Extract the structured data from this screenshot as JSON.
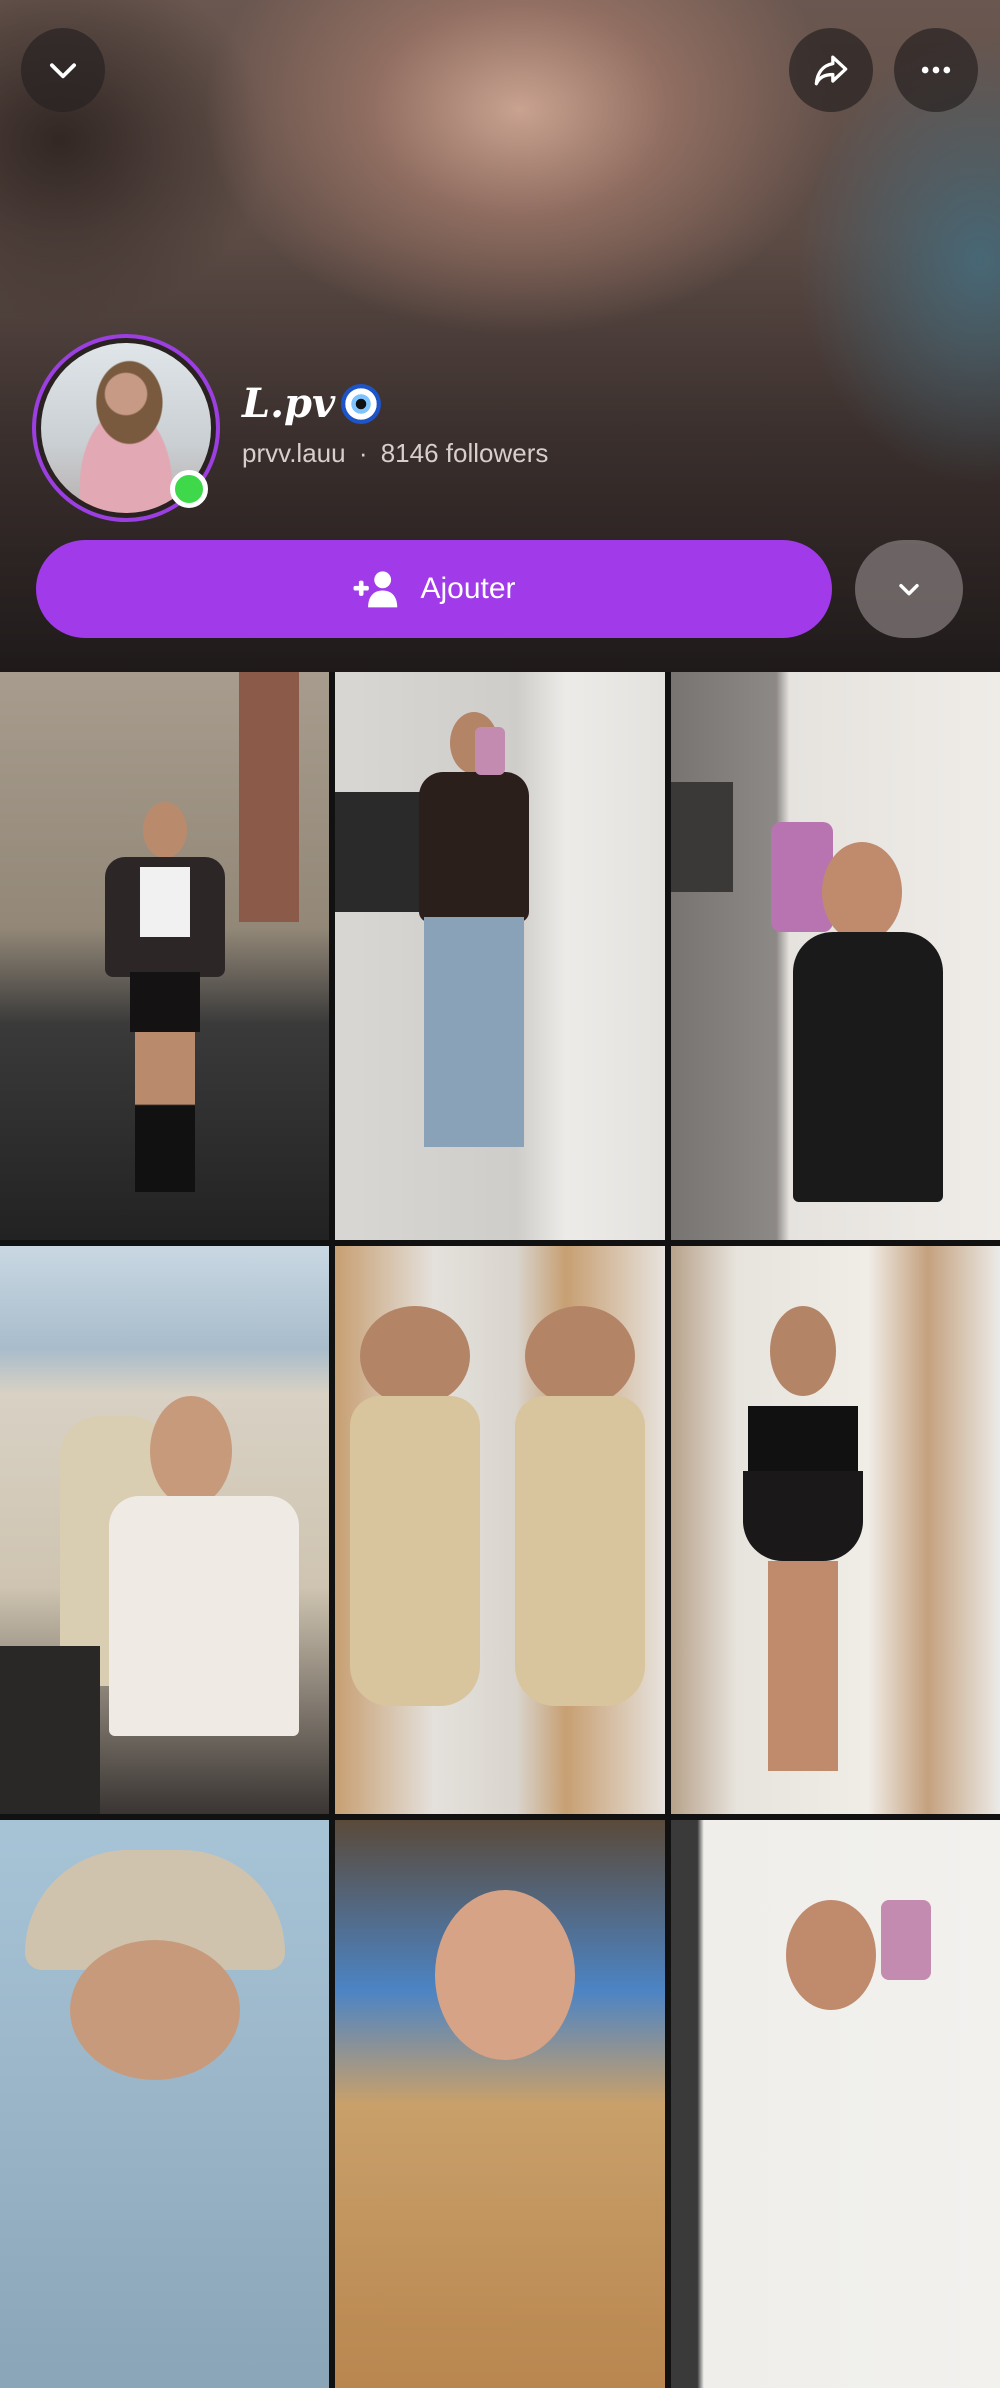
{
  "header": {
    "icons": {
      "collapse": "chevron-down-icon",
      "share": "share-arrow-icon",
      "more": "more-dots-icon"
    },
    "accent_color": "#a13ae8",
    "ring_color": "#9b3fe0",
    "online_color": "#3fd84a"
  },
  "profile": {
    "display_name": "L.pv",
    "display_emoji": "🧿",
    "username": "prvv.lauu",
    "separator": "·",
    "followers": "8146 followers"
  },
  "actions": {
    "add_label": "Ajouter",
    "add_icon": "add-friend-icon",
    "expand_icon": "chevron-down-icon"
  },
  "grid": {
    "tiles": [
      {
        "id": "story-1",
        "icon": "photo"
      },
      {
        "id": "story-2",
        "icon": "photo"
      },
      {
        "id": "story-3",
        "icon": "photo"
      },
      {
        "id": "story-4",
        "icon": "photo"
      },
      {
        "id": "story-5",
        "icon": "photo"
      },
      {
        "id": "story-6",
        "icon": "photo"
      },
      {
        "id": "story-7",
        "icon": "photo"
      },
      {
        "id": "story-8",
        "icon": "photo"
      },
      {
        "id": "story-9",
        "icon": "photo"
      }
    ]
  }
}
